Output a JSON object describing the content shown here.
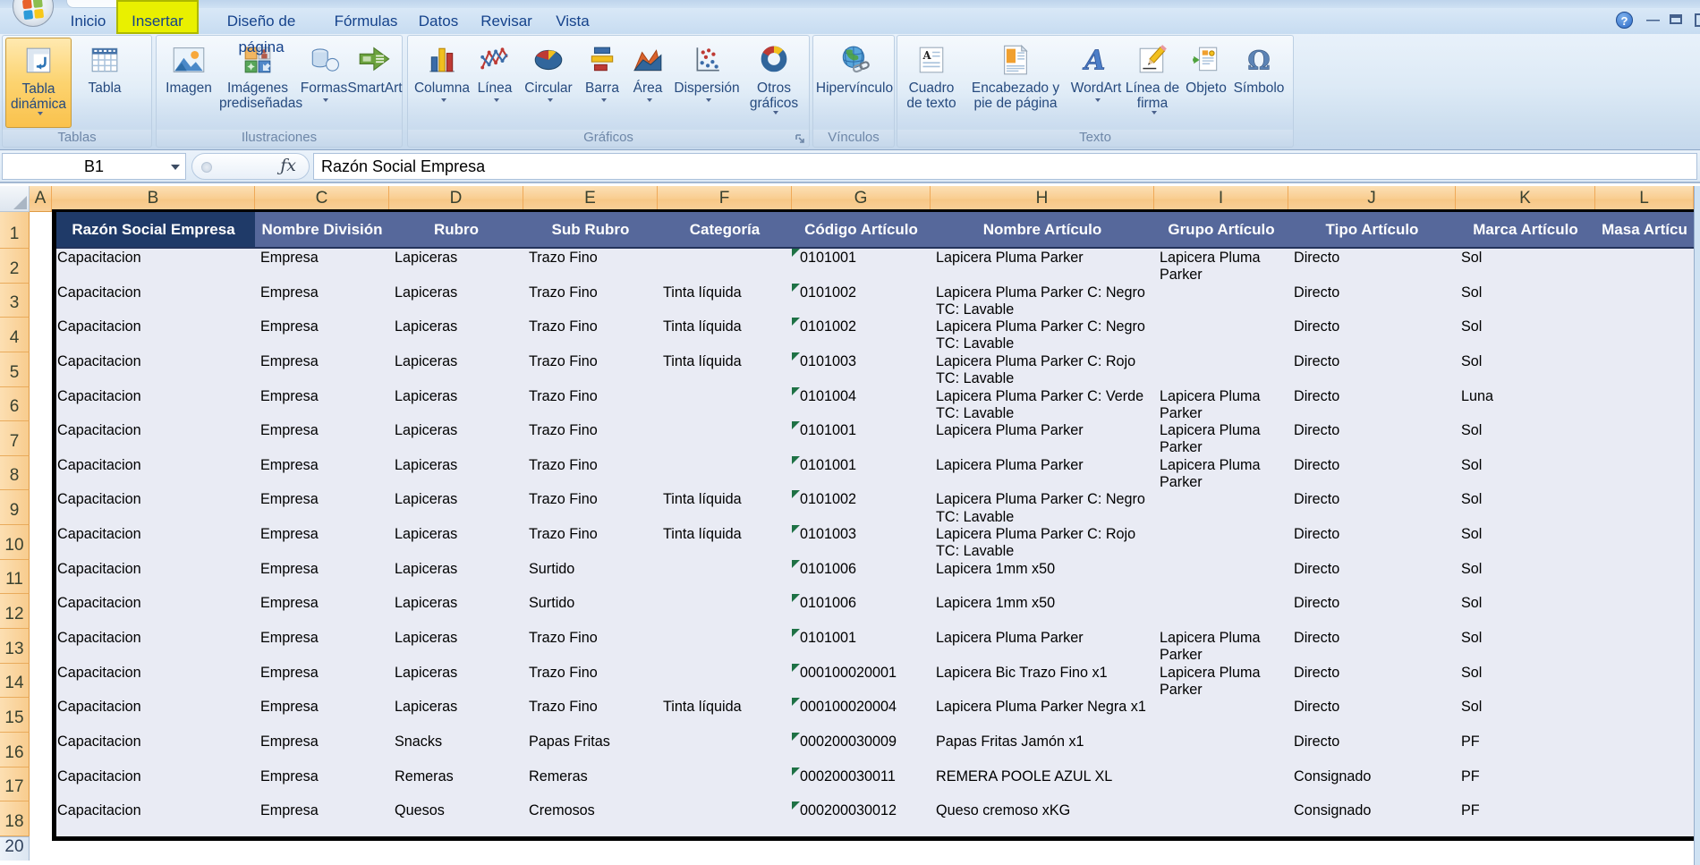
{
  "window": {
    "help_glyph": "?"
  },
  "tabs": {
    "items": [
      {
        "label": "Inicio",
        "active": false
      },
      {
        "label": "Insertar",
        "active": true,
        "highlight_color": "#E9F000"
      },
      {
        "label": "Diseño de página",
        "active": false
      },
      {
        "label": "Fórmulas",
        "active": false
      },
      {
        "label": "Datos",
        "active": false
      },
      {
        "label": "Revisar",
        "active": false
      },
      {
        "label": "Vista",
        "active": false
      }
    ]
  },
  "ribbon": {
    "groups": [
      {
        "label": "Tablas",
        "buttons": [
          {
            "label": "Tabla dinámica",
            "dropdown": true,
            "highlighted": true
          },
          {
            "label": "Tabla",
            "dropdown": false
          }
        ]
      },
      {
        "label": "Ilustraciones",
        "buttons": [
          {
            "label": "Imagen",
            "dropdown": false
          },
          {
            "label": "Imágenes prediseñadas",
            "dropdown": false
          },
          {
            "label": "Formas",
            "dropdown": true
          },
          {
            "label": "SmartArt",
            "dropdown": false
          }
        ]
      },
      {
        "label": "Gráficos",
        "buttons": [
          {
            "label": "Columna",
            "dropdown": true
          },
          {
            "label": "Línea",
            "dropdown": true
          },
          {
            "label": "Circular",
            "dropdown": true
          },
          {
            "label": "Barra",
            "dropdown": true
          },
          {
            "label": "Área",
            "dropdown": true
          },
          {
            "label": "Dispersión",
            "dropdown": true
          },
          {
            "label": "Otros gráficos",
            "dropdown": true
          }
        ]
      },
      {
        "label": "Vínculos",
        "buttons": [
          {
            "label": "Hipervínculo",
            "dropdown": false
          }
        ]
      },
      {
        "label": "Texto",
        "buttons": [
          {
            "label": "Cuadro de texto",
            "dropdown": false
          },
          {
            "label": "Encabezado y pie de página",
            "dropdown": false
          },
          {
            "label": "WordArt",
            "dropdown": true
          },
          {
            "label": "Línea de firma",
            "dropdown": true
          },
          {
            "label": "Objeto",
            "dropdown": false
          },
          {
            "label": "Símbolo",
            "dropdown": false
          }
        ]
      }
    ]
  },
  "formula_bar": {
    "name_box": "B1",
    "fx_glyph": "ƒx",
    "value": "Razón Social Empresa"
  },
  "sheet": {
    "col_letters": [
      "A",
      "B",
      "C",
      "D",
      "E",
      "F",
      "G",
      "H",
      "I",
      "J",
      "K",
      "L"
    ],
    "header_row": [
      "Razón Social Empresa",
      "Nombre División",
      "Rubro",
      "Sub Rubro",
      "Categoría",
      "Código Artículo",
      "Nombre Artículo",
      "Grupo Artículo",
      "Tipo Artículo",
      "Marca Artículo",
      "Masa Artícu"
    ],
    "active_cell": "B1",
    "bottom_partial_row": "20",
    "rows": [
      {
        "n": "2",
        "cells": [
          "Capacitacion",
          "Empresa",
          "Lapiceras",
          "Trazo Fino",
          "",
          "0101001",
          "Lapicera Pluma Parker",
          "Lapicera Pluma Parker",
          "Directo",
          "Sol"
        ]
      },
      {
        "n": "3",
        "cells": [
          "Capacitacion",
          "Empresa",
          "Lapiceras",
          "Trazo Fino",
          "Tinta líquida",
          "0101002",
          "Lapicera Pluma Parker C: Negro TC: Lavable",
          "",
          "Directo",
          "Sol"
        ]
      },
      {
        "n": "4",
        "cells": [
          "Capacitacion",
          "Empresa",
          "Lapiceras",
          "Trazo Fino",
          "Tinta líquida",
          "0101002",
          "Lapicera Pluma Parker C: Negro TC: Lavable",
          "",
          "Directo",
          "Sol"
        ]
      },
      {
        "n": "5",
        "cells": [
          "Capacitacion",
          "Empresa",
          "Lapiceras",
          "Trazo Fino",
          "Tinta líquida",
          "0101003",
          "Lapicera Pluma Parker C: Rojo TC: Lavable",
          "",
          "Directo",
          "Sol"
        ]
      },
      {
        "n": "6",
        "cells": [
          "Capacitacion",
          "Empresa",
          "Lapiceras",
          "Trazo Fino",
          "",
          "0101004",
          "Lapicera Pluma Parker C: Verde TC: Lavable",
          "Lapicera Pluma Parker",
          "Directo",
          "Luna"
        ]
      },
      {
        "n": "7",
        "cells": [
          "Capacitacion",
          "Empresa",
          "Lapiceras",
          "Trazo Fino",
          "",
          "0101001",
          "Lapicera Pluma Parker",
          "Lapicera Pluma Parker",
          "Directo",
          "Sol"
        ]
      },
      {
        "n": "8",
        "cells": [
          "Capacitacion",
          "Empresa",
          "Lapiceras",
          "Trazo Fino",
          "",
          "0101001",
          "Lapicera Pluma Parker",
          "Lapicera Pluma Parker",
          "Directo",
          "Sol"
        ]
      },
      {
        "n": "9",
        "cells": [
          "Capacitacion",
          "Empresa",
          "Lapiceras",
          "Trazo Fino",
          "Tinta líquida",
          "0101002",
          "Lapicera Pluma Parker C: Negro TC: Lavable",
          "",
          "Directo",
          "Sol"
        ]
      },
      {
        "n": "10",
        "cells": [
          "Capacitacion",
          "Empresa",
          "Lapiceras",
          "Trazo Fino",
          "Tinta líquida",
          "0101003",
          "Lapicera Pluma Parker C: Rojo TC: Lavable",
          "",
          "Directo",
          "Sol"
        ]
      },
      {
        "n": "11",
        "cells": [
          "Capacitacion",
          "Empresa",
          "Lapiceras",
          "Surtido",
          "",
          "0101006",
          "Lapicera 1mm x50",
          "",
          "Directo",
          "Sol"
        ]
      },
      {
        "n": "12",
        "cells": [
          "Capacitacion",
          "Empresa",
          "Lapiceras",
          "Surtido",
          "",
          "0101006",
          "Lapicera 1mm x50",
          "",
          "Directo",
          "Sol"
        ]
      },
      {
        "n": "13",
        "cells": [
          "Capacitacion",
          "Empresa",
          "Lapiceras",
          "Trazo Fino",
          "",
          "0101001",
          "Lapicera Pluma Parker",
          "Lapicera Pluma Parker",
          "Directo",
          "Sol"
        ]
      },
      {
        "n": "14",
        "cells": [
          "Capacitacion",
          "Empresa",
          "Lapiceras",
          "Trazo Fino",
          "",
          "000100020001",
          "Lapicera Bic Trazo Fino x1",
          "Lapicera Pluma Parker",
          "Directo",
          "Sol"
        ]
      },
      {
        "n": "15",
        "cells": [
          "Capacitacion",
          "Empresa",
          "Lapiceras",
          "Trazo Fino",
          "Tinta líquida",
          "000100020004",
          "Lapicera Pluma Parker Negra x1",
          "",
          "Directo",
          "Sol"
        ]
      },
      {
        "n": "16",
        "cells": [
          "Capacitacion",
          "Empresa",
          "Snacks",
          "Papas Fritas",
          "",
          "000200030009",
          "Papas Fritas Jamón x1",
          "",
          "Directo",
          "PF"
        ]
      },
      {
        "n": "17",
        "cells": [
          "Capacitacion",
          "Empresa",
          "Remeras",
          "Remeras",
          "",
          "000200030011",
          "REMERA POOLE AZUL XL",
          "",
          "Consignado",
          "PF"
        ]
      },
      {
        "n": "18",
        "cells": [
          "Capacitacion",
          "Empresa",
          "Quesos",
          "Cremosos",
          "",
          "000200030012",
          "Queso cremoso xKG",
          "",
          "Consignado",
          "PF"
        ]
      }
    ]
  },
  "colors": {
    "tab_highlight": "#E9F000",
    "header_row_fill": "#56689B",
    "active_cell_fill": "#1F3A68",
    "selection_fill": "#E9EBF4",
    "selected_header_orange": "#F9CE92",
    "error_marker_green": "#1E7145"
  }
}
